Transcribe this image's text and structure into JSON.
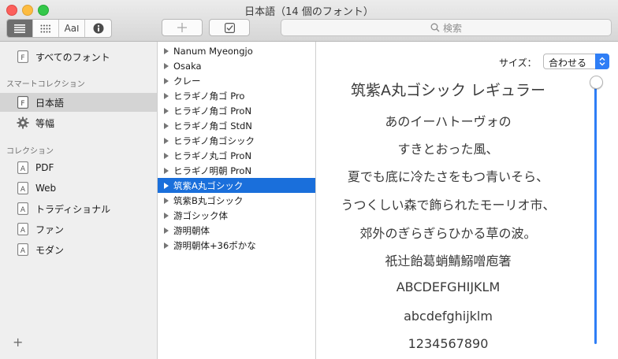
{
  "window": {
    "title": "日本語（14 個のフォント）"
  },
  "toolbar": {
    "view_buttons": [
      {
        "icon": "list-lines-icon"
      },
      {
        "icon": "grid-dots-icon"
      },
      {
        "icon": "font-sample-icon",
        "label": "Aa"
      },
      {
        "icon": "info-icon"
      }
    ],
    "add_icon": "plus-icon",
    "check_icon": "checkbox-icon",
    "search": {
      "placeholder": "検索",
      "icon": "search-icon"
    }
  },
  "sidebar": {
    "all_fonts": "すべてのフォント",
    "smart_header": "スマートコレクション",
    "smart_items": [
      {
        "label": "日本語",
        "icon": "f-collection-icon",
        "selected": true
      },
      {
        "label": "等幅",
        "icon": "gear-icon",
        "selected": false
      }
    ],
    "collections_header": "コレクション",
    "collections": [
      {
        "label": "PDF"
      },
      {
        "label": "Web"
      },
      {
        "label": "トラディショナル"
      },
      {
        "label": "ファン"
      },
      {
        "label": "モダン"
      }
    ],
    "add_label": "+"
  },
  "fonts": [
    {
      "name": "Nanum Myeongjo"
    },
    {
      "name": "Osaka"
    },
    {
      "name": "クレー"
    },
    {
      "name": "ヒラギノ角ゴ Pro"
    },
    {
      "name": "ヒラギノ角ゴ ProN"
    },
    {
      "name": "ヒラギノ角ゴ StdN"
    },
    {
      "name": "ヒラギノ角ゴシック"
    },
    {
      "name": "ヒラギノ丸ゴ ProN"
    },
    {
      "name": "ヒラギノ明朝 ProN"
    },
    {
      "name": "筑紫A丸ゴシック",
      "selected": true
    },
    {
      "name": "筑紫B丸ゴシック"
    },
    {
      "name": "游ゴシック体"
    },
    {
      "name": "游明朝体"
    },
    {
      "name": "游明朝体+36ポかな"
    }
  ],
  "preview": {
    "size_label": "サイズ：",
    "size_value": "合わせる",
    "lines": [
      "筑紫A丸ゴシック レギュラー",
      "あのイーハトーヴォの",
      "すきとおった風、",
      "夏でも底に冷たさをもつ青いそら、",
      "うつくしい森で飾られたモーリオ市、",
      "郊外のぎらぎらひかる草の波。",
      "祇辻飴葛蛸鯖鰯噌庖箸",
      "ABCDEFGHIJKLM",
      "abcdefghijklm",
      "1234567890"
    ]
  },
  "colors": {
    "accent": "#2f7ef6",
    "selection": "#1a6fdb",
    "sidebar_selected": "#d4d4d4"
  }
}
